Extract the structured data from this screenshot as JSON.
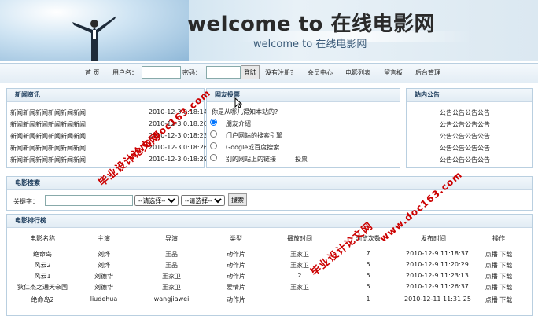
{
  "banner": {
    "title": "welcome to 在线电影网",
    "subtitle": "welcome to 在线电影网"
  },
  "nav": {
    "home": "首 页",
    "username_label": "用户名：",
    "password_label": "密码：",
    "login_button": "登陆",
    "register": "没有注册？",
    "links": [
      "会员中心",
      "电影列表",
      "留言板",
      "后台管理"
    ]
  },
  "news": {
    "title": "新闻资讯",
    "items": [
      {
        "text": "新闻新闻新闻新闻新闻新闻",
        "date": "2010-12-3 0:18:14"
      },
      {
        "text": "新闻新闻新闻新闻新闻新闻",
        "date": "2010-12-3 0:18:20"
      },
      {
        "text": "新闻新闻新闻新闻新闻新闻",
        "date": "2010-12-3 0:18:23"
      },
      {
        "text": "新闻新闻新闻新闻新闻新闻",
        "date": "2010-12-3 0:18:26"
      },
      {
        "text": "新闻新闻新闻新闻新闻新闻",
        "date": "2010-12-3 0:18:29"
      }
    ]
  },
  "poll": {
    "title": "网友投票",
    "question": "你是从哪儿得知本站的?",
    "options": [
      "朋友介绍",
      "门户网站的搜索引擎",
      "Google或百度搜索",
      "别的网站上的链接"
    ],
    "vote_label": "投票"
  },
  "notice": {
    "title": "站内公告",
    "items": [
      "公告公告公告公告",
      "公告公告公告公告",
      "公告公告公告公告",
      "公告公告公告公告",
      "公告公告公告公告"
    ]
  },
  "search": {
    "title": "电影搜索",
    "keyword_label": "关键字：",
    "select1": "--请选择--",
    "select2": "--请选择--",
    "button": "搜索"
  },
  "ranking": {
    "title": "电影排行榜",
    "headers": [
      "电影名称",
      "主演",
      "导演",
      "类型",
      "播放时间",
      "浏览次数",
      "发布时间",
      "操作"
    ],
    "rows": [
      [
        "绝命岛",
        "刘烨",
        "王晶",
        "动作片",
        "王家卫",
        "7",
        "2010-12-9 11:18:37",
        "点播  下载"
      ],
      [
        "风云2",
        "刘烨",
        "王晶",
        "动作片",
        "王家卫",
        "5",
        "2010-12-9 11:20:29",
        "点播  下载"
      ],
      [
        "风云1",
        "刘德华",
        "王家卫",
        "动作片",
        "2",
        "5",
        "2010-12-9 11:23:13",
        "点播  下载"
      ],
      [
        "狄仁杰之通天帝国",
        "刘德华",
        "王家卫",
        "爱情片",
        "王家卫",
        "5",
        "2010-12-9 11:26:37",
        "点播  下载"
      ],
      [
        "绝命岛2",
        "liudehua",
        "wangjiawei",
        "动作片",
        "",
        "1",
        "2010-12-11 11:31:25",
        "点播  下载"
      ]
    ]
  },
  "watermark": {
    "a": "毕业设计论文网",
    "b": "www.doc163.com"
  }
}
